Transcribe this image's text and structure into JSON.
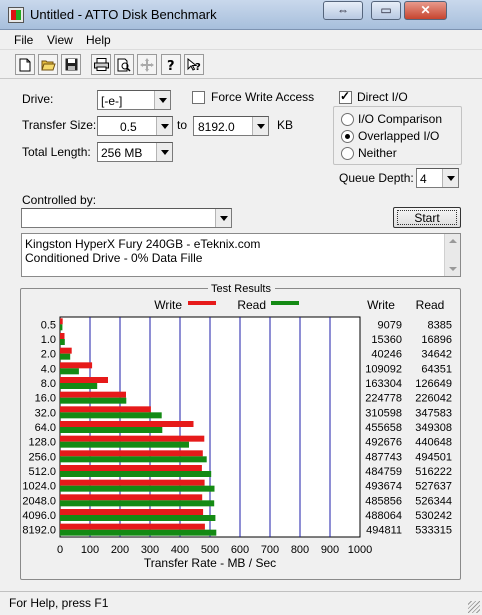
{
  "window": {
    "title": "Untitled - ATTO Disk Benchmark",
    "buttons": {
      "minimize": "⇔",
      "maximize": "▭",
      "close": "✕"
    }
  },
  "menu": {
    "file": "File",
    "view": "View",
    "help": "Help"
  },
  "toolbar": {
    "icons": [
      "new-file-icon",
      "open-folder-icon",
      "save-icon",
      "print-icon",
      "print-preview-icon",
      "move-icon",
      "help-icon",
      "context-help-icon"
    ]
  },
  "form": {
    "drive_label": "Drive:",
    "drive_value": "[-e-]",
    "force_write_label": "Force Write Access",
    "force_write_checked": false,
    "direct_io_label": "Direct I/O",
    "direct_io_checked": true,
    "transfer_size_label": "Transfer Size:",
    "transfer_from": "0.5",
    "to_label": "to",
    "transfer_to": "8192.0",
    "kb_label": "KB",
    "total_length_label": "Total Length:",
    "total_length_value": "256 MB",
    "io_options": [
      "I/O Comparison",
      "Overlapped I/O",
      "Neither"
    ],
    "io_selected": "Overlapped I/O",
    "queue_depth_label": "Queue Depth:",
    "queue_depth_value": "4",
    "controlled_by_label": "Controlled by:",
    "controlled_by_value": "",
    "start_button": "Start",
    "description_lines": [
      "Kingston HyperX Fury 240GB - eTeknix.com",
      "Conditioned Drive - 0% Data Fille"
    ]
  },
  "results": {
    "title": "Test Results",
    "write_header": "Write",
    "read_header": "Read"
  },
  "chart_data": {
    "type": "bar",
    "orientation": "horizontal",
    "title": "Test Results",
    "xlabel": "Transfer Rate - MB / Sec",
    "xlim": [
      0,
      1000
    ],
    "xticks": [
      "0",
      "100",
      "200",
      "300",
      "400",
      "500",
      "600",
      "700",
      "800",
      "900",
      "1000"
    ],
    "categories": [
      "0.5",
      "1.0",
      "2.0",
      "4.0",
      "8.0",
      "16.0",
      "32.0",
      "64.0",
      "128.0",
      "256.0",
      "512.0",
      "1024.0",
      "2048.0",
      "4096.0",
      "8192.0"
    ],
    "series": [
      {
        "name": "Write",
        "color": "#e61a1a",
        "values": [
          9,
          15,
          39,
          107,
          160,
          220,
          303,
          445,
          481,
          476,
          473,
          482,
          474,
          477,
          483
        ],
        "labels": [
          "9079",
          "15360",
          "40246",
          "109092",
          "163304",
          "224778",
          "310598",
          "455658",
          "492676",
          "487743",
          "484759",
          "493674",
          "485856",
          "488064",
          "494811"
        ]
      },
      {
        "name": "Read",
        "color": "#148a14",
        "values": [
          8,
          16,
          34,
          63,
          124,
          221,
          339,
          341,
          430,
          489,
          504,
          515,
          514,
          518,
          521
        ],
        "labels": [
          "8385",
          "16896",
          "34642",
          "64351",
          "126649",
          "226042",
          "347583",
          "349308",
          "440648",
          "494501",
          "516222",
          "527637",
          "526344",
          "530242",
          "533315"
        ]
      }
    ]
  },
  "status": {
    "text": "For Help, press F1"
  }
}
